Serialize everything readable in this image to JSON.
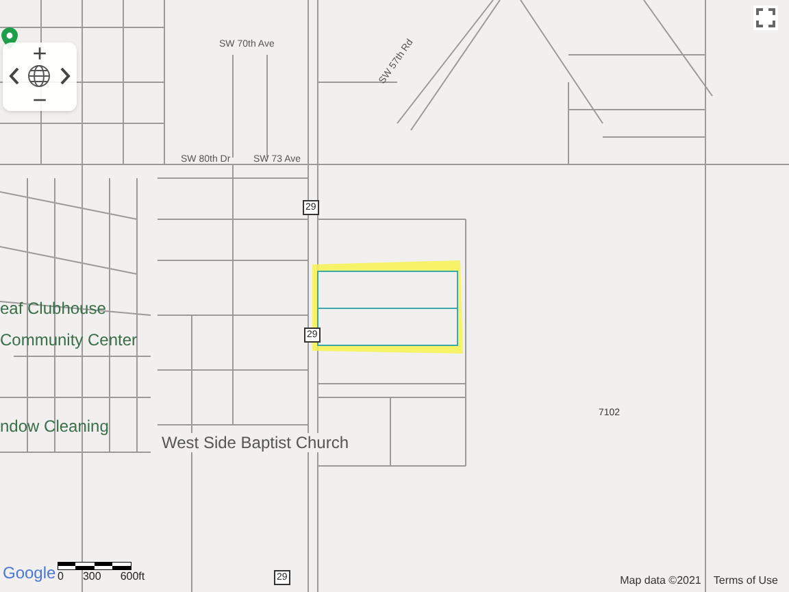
{
  "map": {
    "labels": [
      {
        "kind": "street",
        "text": "SW 70th Ave"
      },
      {
        "kind": "street",
        "text": "SW 80th Dr"
      },
      {
        "kind": "street",
        "text": "SW 73 Ave"
      },
      {
        "kind": "street",
        "text": "SW 57th Rd"
      },
      {
        "kind": "place",
        "text": "eaf Clubhouse"
      },
      {
        "kind": "place",
        "text": "Community Center"
      },
      {
        "kind": "place",
        "text": "ndow Cleaning"
      },
      {
        "kind": "place",
        "text": "West Side Baptist Church"
      },
      {
        "kind": "parcel",
        "text": "7102"
      },
      {
        "kind": "shield",
        "text": "29"
      },
      {
        "kind": "shield",
        "text": "29"
      },
      {
        "kind": "shield",
        "text": "29"
      }
    ]
  },
  "controls": {
    "zoom_in": "+",
    "zoom_out": "−"
  },
  "footer": {
    "logo": "Google",
    "scale": [
      "0",
      "300",
      "600ft"
    ],
    "attribution": "Map data ©2021",
    "terms": "Terms of Use"
  }
}
